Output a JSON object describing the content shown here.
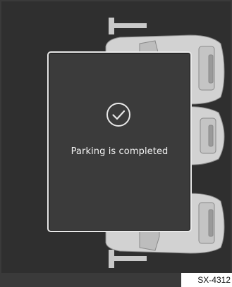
{
  "popup": {
    "message": "Parking is completed",
    "icon": "checkmark-circle-icon"
  },
  "figure_code": "SX-4312",
  "colors": {
    "screen_bg": "#2f2f2f",
    "marker": "#c9c9c9",
    "car_body": "#d2d2d2",
    "popup_bg": "#3b3b3b",
    "popup_border": "#e9e9e9"
  }
}
